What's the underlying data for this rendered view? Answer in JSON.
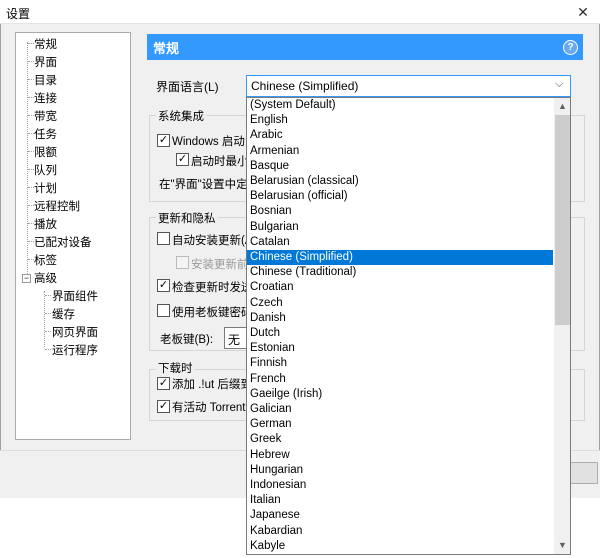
{
  "window": {
    "title": "设置"
  },
  "tree": {
    "items": [
      "常规",
      "界面",
      "目录",
      "连接",
      "带宽",
      "任务",
      "限额",
      "队列",
      "计划",
      "远程控制",
      "播放",
      "已配对设备",
      "标签",
      "高级"
    ],
    "subitems": [
      "界面组件",
      "缓存",
      "网页界面",
      "运行程序"
    ],
    "expander": "−"
  },
  "header": {
    "title": "常规",
    "help": "?"
  },
  "language": {
    "label": "界面语言(L)",
    "selected": "Chinese (Simplified)",
    "options": [
      "(System Default)",
      "English",
      "Arabic",
      "Armenian",
      "Basque",
      "Belarusian (classical)",
      "Belarusian (official)",
      "Bosnian",
      "Bulgarian",
      "Catalan",
      "Chinese (Simplified)",
      "Chinese (Traditional)",
      "Croatian",
      "Czech",
      "Danish",
      "Dutch",
      "Estonian",
      "Finnish",
      "French",
      "Gaeilge (Irish)",
      "Galician",
      "German",
      "Greek",
      "Hebrew",
      "Hungarian",
      "Indonesian",
      "Italian",
      "Japanese",
      "Kabardian",
      "Kabyle"
    ],
    "selected_index": 10
  },
  "system_integration": {
    "title": "系统集成",
    "windows_start": "Windows 启动",
    "start_minimized": "启动时最小",
    "interface_note": "在\"界面\"设置中定义"
  },
  "updates_privacy": {
    "title": "更新和隐私",
    "auto_install": "自动安装更新(A",
    "install_before": "安装更新前",
    "check_updates": "检查更新时发送",
    "boss_key_password": "使用老板键密码",
    "boss_key_label": "老板键(B):",
    "boss_key_value": "无"
  },
  "downloading": {
    "title": "下载时",
    "append_lut": "添加 .!ut 后缀到",
    "torrent_active": "有活动 Torrent"
  }
}
